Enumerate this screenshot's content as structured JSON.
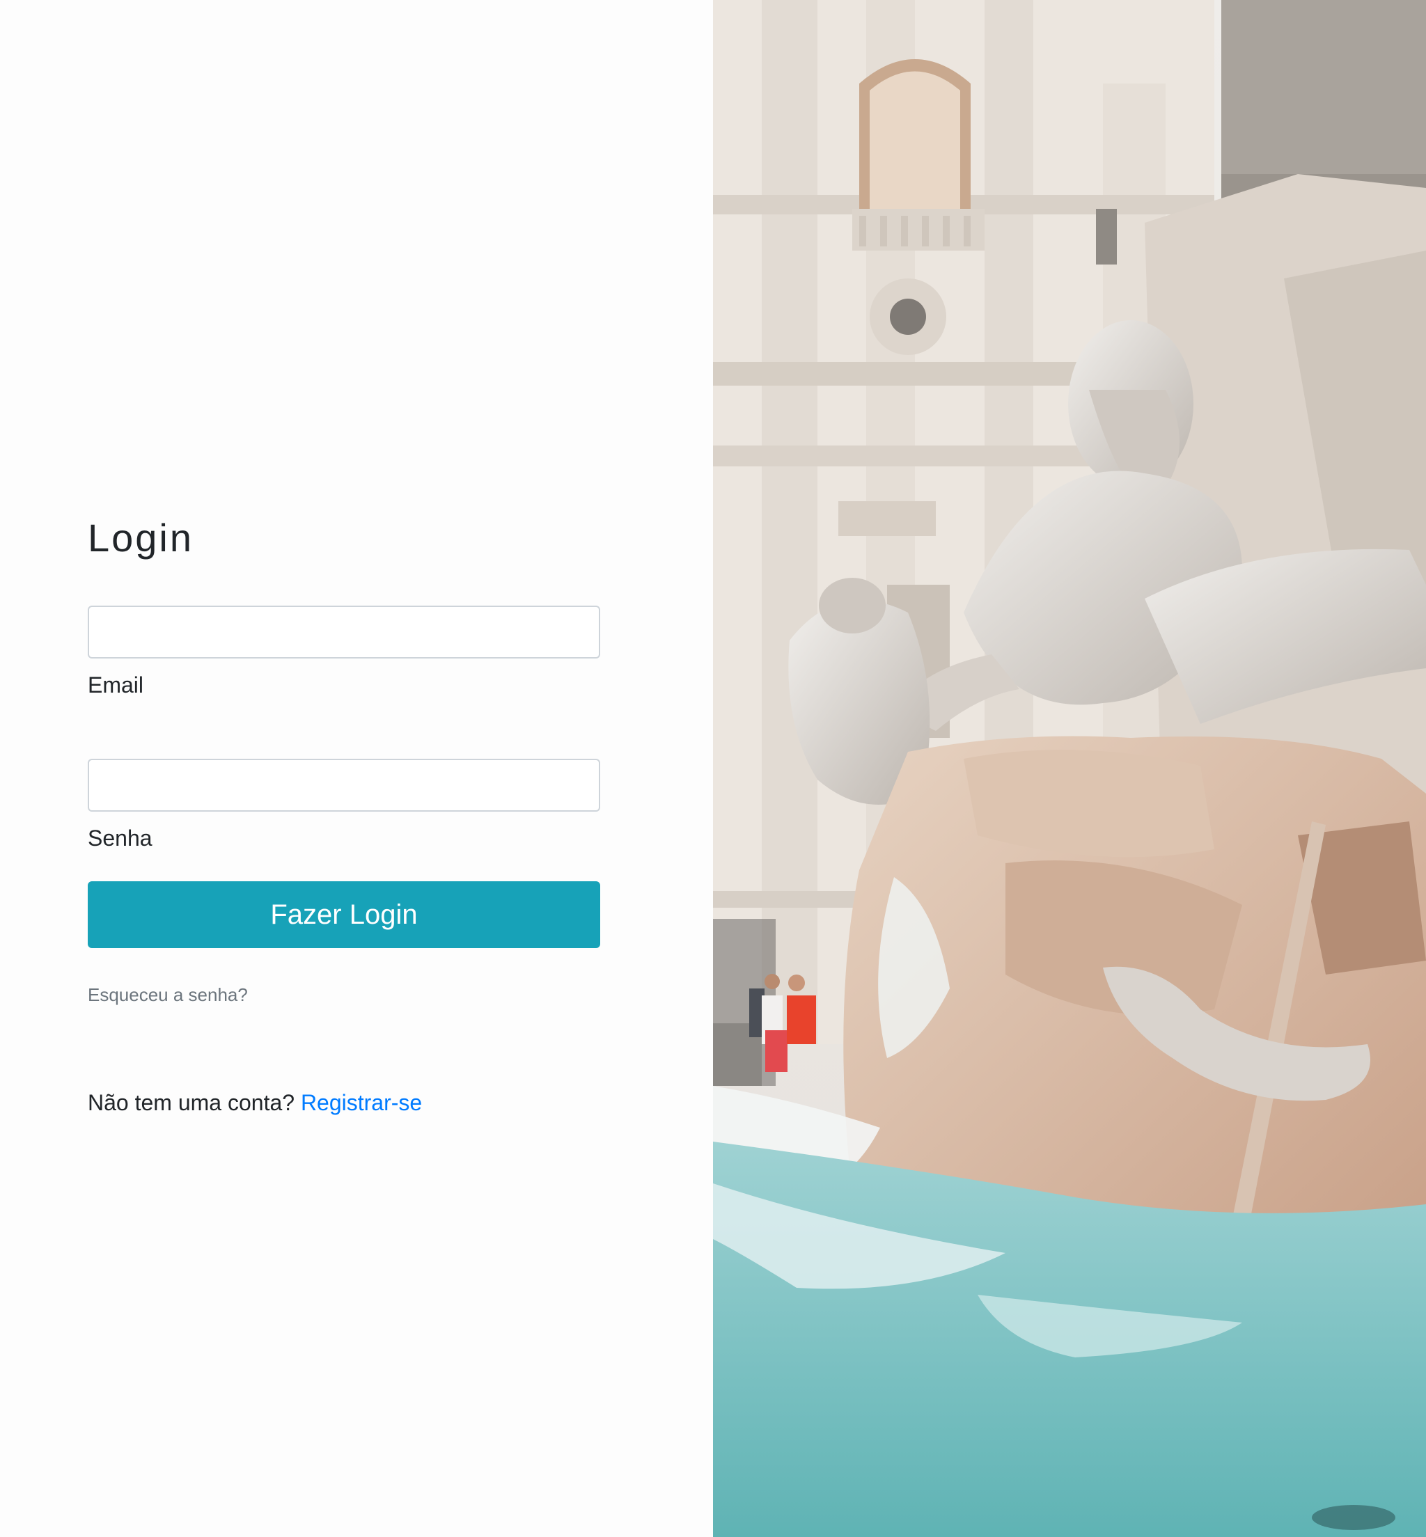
{
  "login": {
    "title": "Login",
    "email": {
      "label": "Email",
      "value": "",
      "placeholder": ""
    },
    "password": {
      "label": "Senha",
      "value": "",
      "placeholder": ""
    },
    "submit_label": "Fazer Login",
    "forgot_label": "Esqueceu a senha?",
    "signup_prompt": "Não tem uma conta?",
    "signup_link": "Registrar-se"
  },
  "colors": {
    "primary_button": "#17a2b8",
    "link": "#007bff",
    "muted_text": "#6c757d"
  },
  "hero_image": {
    "subject": "baroque marble fountain statue in front of a church facade"
  }
}
